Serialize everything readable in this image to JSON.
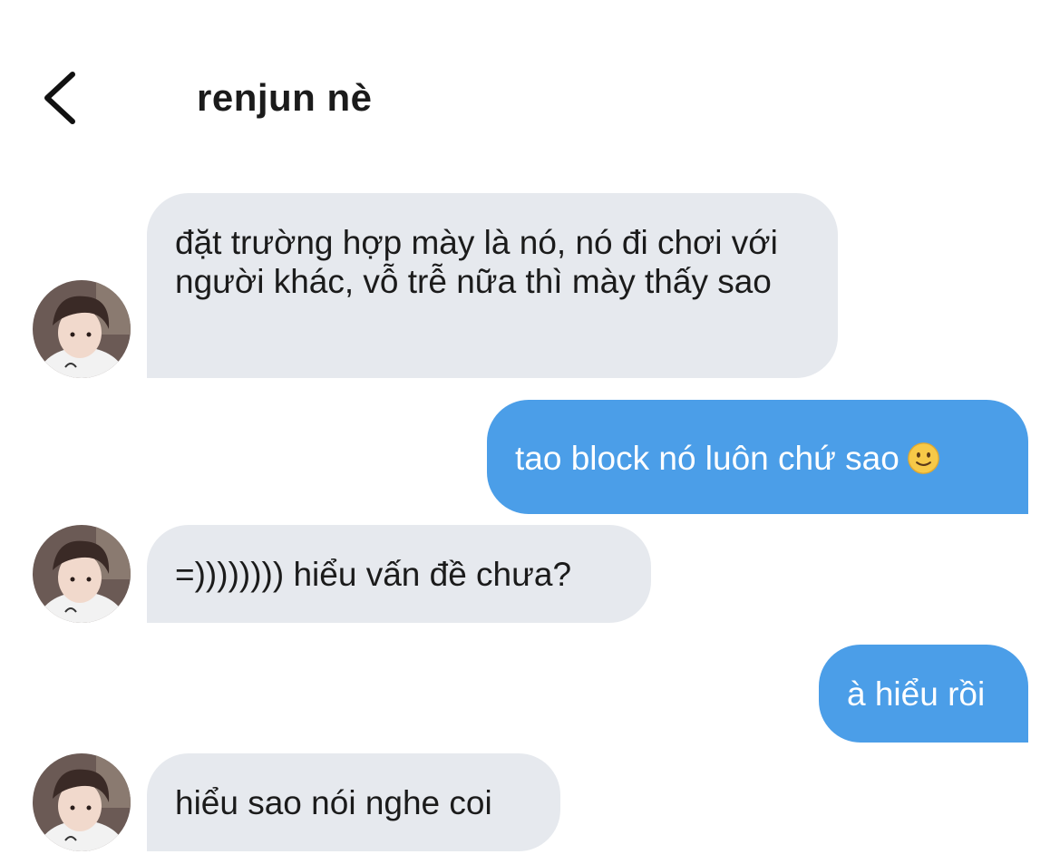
{
  "header": {
    "back_icon": "chevron-left-icon",
    "title": "renjun nè"
  },
  "messages": [
    {
      "direction": "incoming",
      "text": "đặt trường hợp mày là nó, nó đi chơi với người khác, vỗ trễ nữa thì mày thấy sao",
      "avatar": "avatar-photo"
    },
    {
      "direction": "outgoing",
      "text": "tao block nó luôn chứ sao",
      "emoji": "slightly-smiling-face-icon"
    },
    {
      "direction": "incoming",
      "text": "=)))))))) hiểu vấn đề chưa?",
      "avatar": "avatar-photo"
    },
    {
      "direction": "outgoing",
      "text": "à hiểu rồi"
    },
    {
      "direction": "incoming",
      "text": "hiểu sao nói nghe coi",
      "avatar": "avatar-photo"
    }
  ],
  "colors": {
    "incoming_bubble": "#e6e9ee",
    "outgoing_bubble": "#4b9ee8",
    "text_dark": "#1b1b1b",
    "text_light": "#ffffff"
  }
}
